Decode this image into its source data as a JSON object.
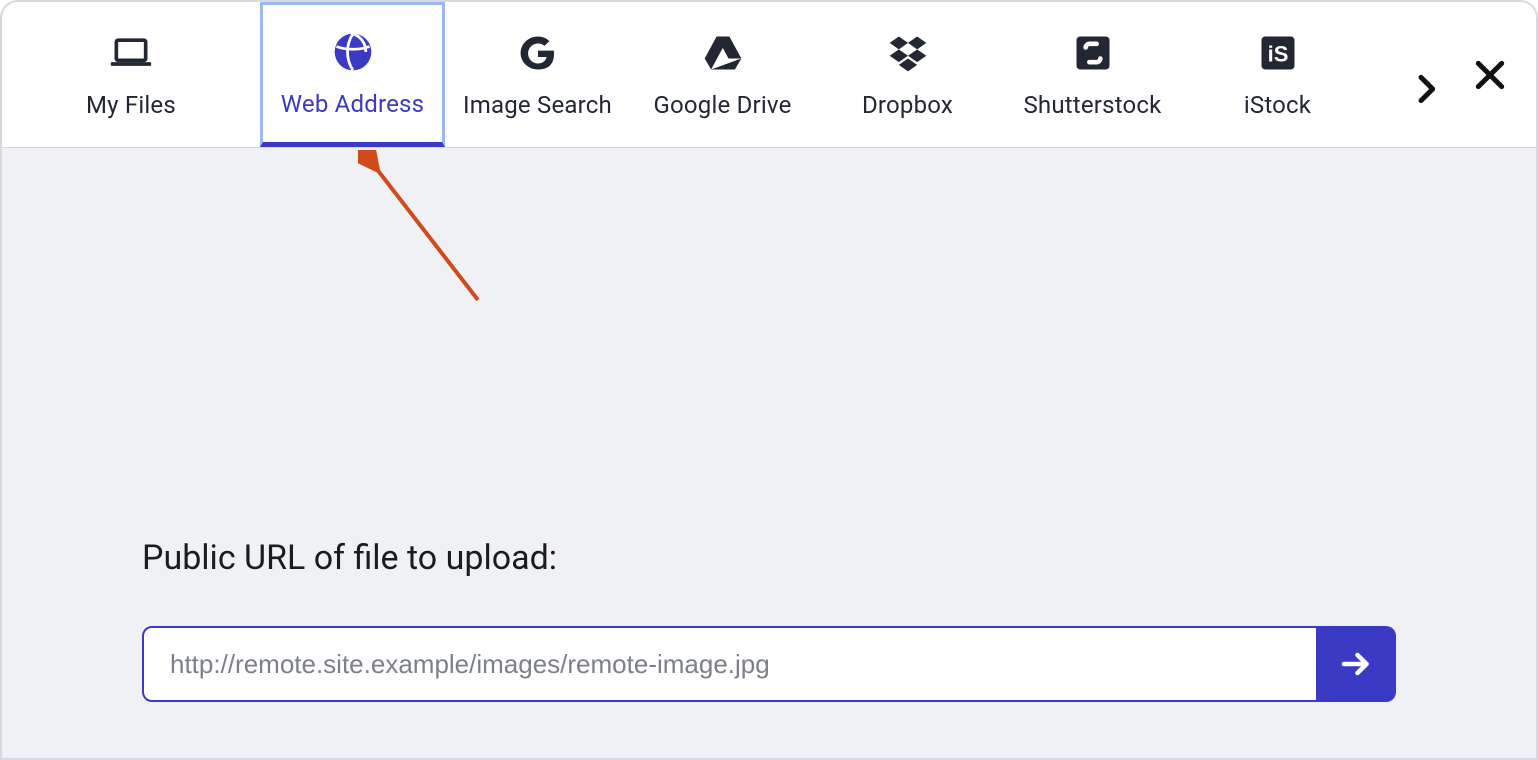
{
  "tabs": [
    {
      "id": "my-files",
      "label": "My Files",
      "icon": "laptop-icon",
      "active": false
    },
    {
      "id": "web-address",
      "label": "Web Address",
      "icon": "globe-icon",
      "active": true
    },
    {
      "id": "image-search",
      "label": "Image Search",
      "icon": "google-g-icon",
      "active": false
    },
    {
      "id": "google-drive",
      "label": "Google Drive",
      "icon": "google-drive-icon",
      "active": false
    },
    {
      "id": "dropbox",
      "label": "Dropbox",
      "icon": "dropbox-icon",
      "active": false
    },
    {
      "id": "shutterstock",
      "label": "Shutterstock",
      "icon": "shutterstock-icon",
      "active": false
    },
    {
      "id": "istock",
      "label": "iStock",
      "icon": "istock-icon",
      "active": false
    }
  ],
  "main": {
    "prompt": "Public URL of file to upload:",
    "url_placeholder": "http://remote.site.example/images/remote-image.jpg",
    "url_value": ""
  },
  "colors": {
    "accent": "#3b3ac4",
    "tab_highlight_border": "#9bb8f2",
    "body_bg": "#f0f1f4",
    "text": "#1a1c21"
  },
  "annotation": {
    "kind": "arrow",
    "color": "#d24a1a",
    "points_to": "tab-web-address"
  }
}
